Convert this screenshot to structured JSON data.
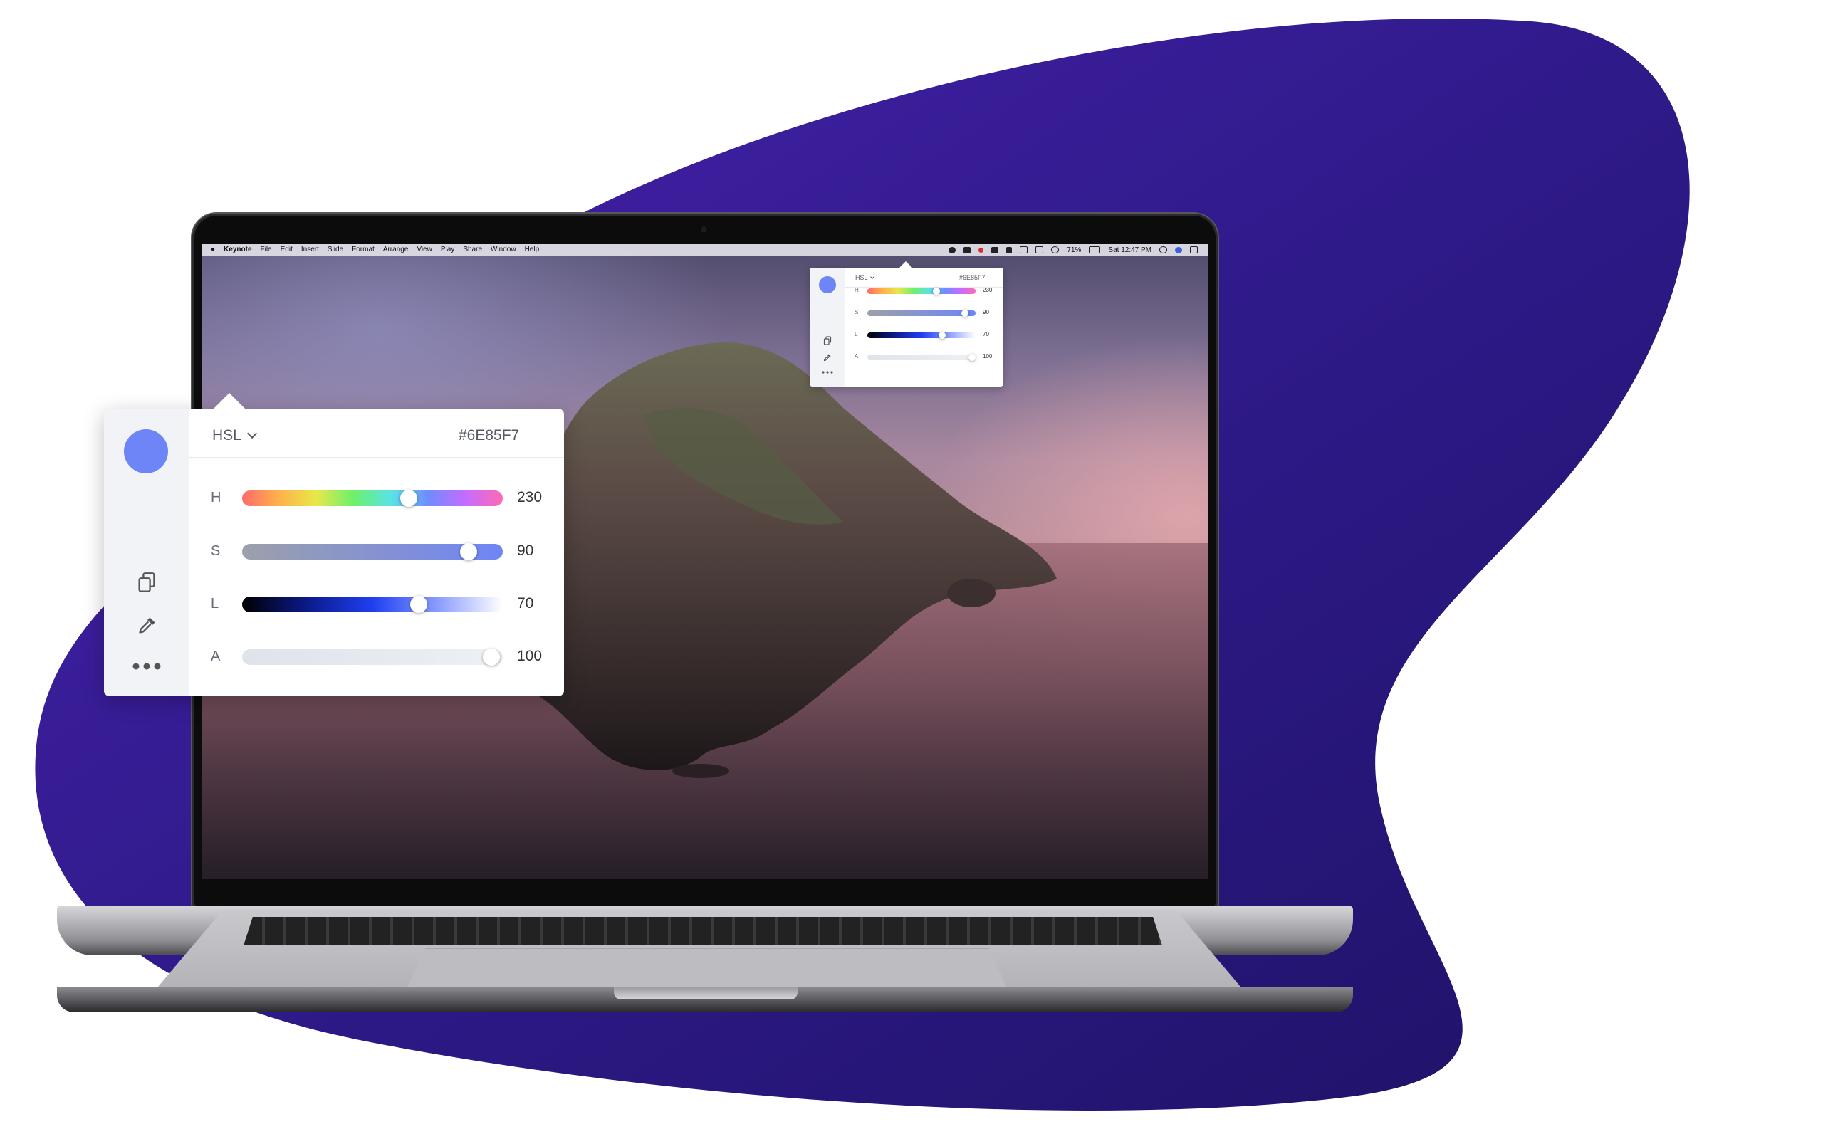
{
  "colors": {
    "blob": "#2f1a8a",
    "swatch": "#6E85F7"
  },
  "menubar": {
    "app": "Keynote",
    "items": [
      "File",
      "Edit",
      "Insert",
      "Slide",
      "Format",
      "Arrange",
      "View",
      "Play",
      "Share",
      "Window",
      "Help"
    ],
    "battery": "71%",
    "clock": "Sat 12:47 PM"
  },
  "picker": {
    "mode": "HSL",
    "hex": "#6E85F7",
    "channels": [
      {
        "label": "H",
        "value": "230",
        "fraction": 0.64
      },
      {
        "label": "S",
        "value": "90",
        "fraction": 0.9
      },
      {
        "label": "L",
        "value": "70",
        "fraction": 0.7
      },
      {
        "label": "A",
        "value": "100",
        "fraction": 1.0
      }
    ]
  },
  "icons": [
    "apple-icon",
    "copy-icon",
    "eyedropper-icon",
    "more-icon"
  ]
}
